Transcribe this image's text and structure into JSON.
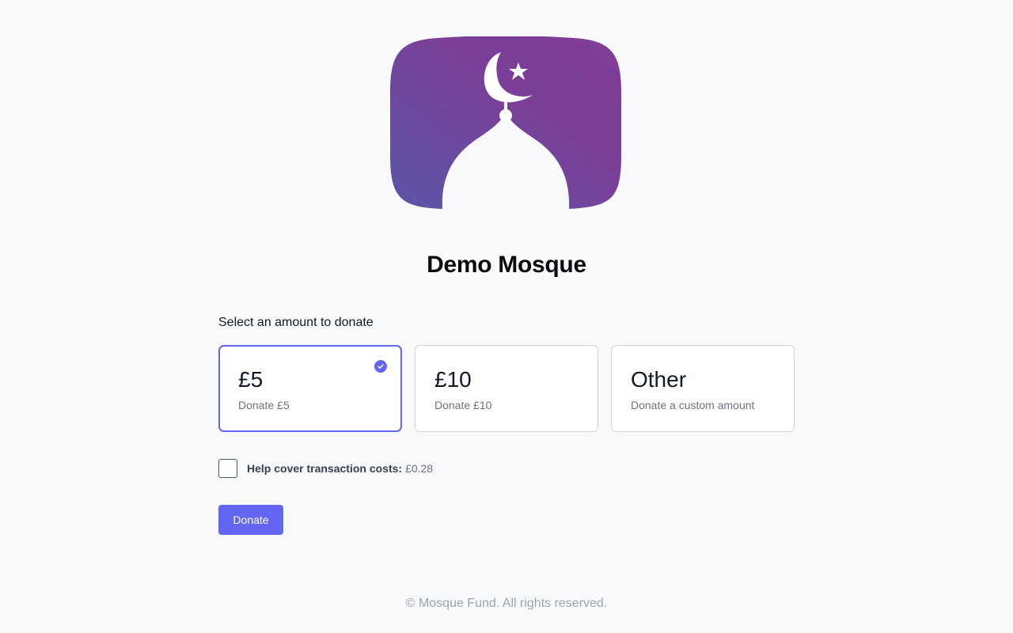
{
  "header": {
    "title": "Demo Mosque"
  },
  "logo": {
    "icon": "mosque-dome-crescent-icon",
    "gradient_start": "#5b55a8",
    "gradient_end": "#7e3c98"
  },
  "donation": {
    "prompt": "Select an amount to donate",
    "options": [
      {
        "amount": "£5",
        "description": "Donate £5",
        "selected": true
      },
      {
        "amount": "£10",
        "description": "Donate £10",
        "selected": false
      },
      {
        "amount": "Other",
        "description": "Donate a custom amount",
        "selected": false
      }
    ],
    "fee": {
      "label": "Help cover transaction costs:",
      "value": "£0.28",
      "checked": false
    },
    "submit_label": "Donate"
  },
  "footer": {
    "text": "© Mosque Fund. All rights reserved."
  },
  "colors": {
    "accent": "#6366f1",
    "background": "#f8f9fb",
    "muted_text": "#6b7280"
  }
}
